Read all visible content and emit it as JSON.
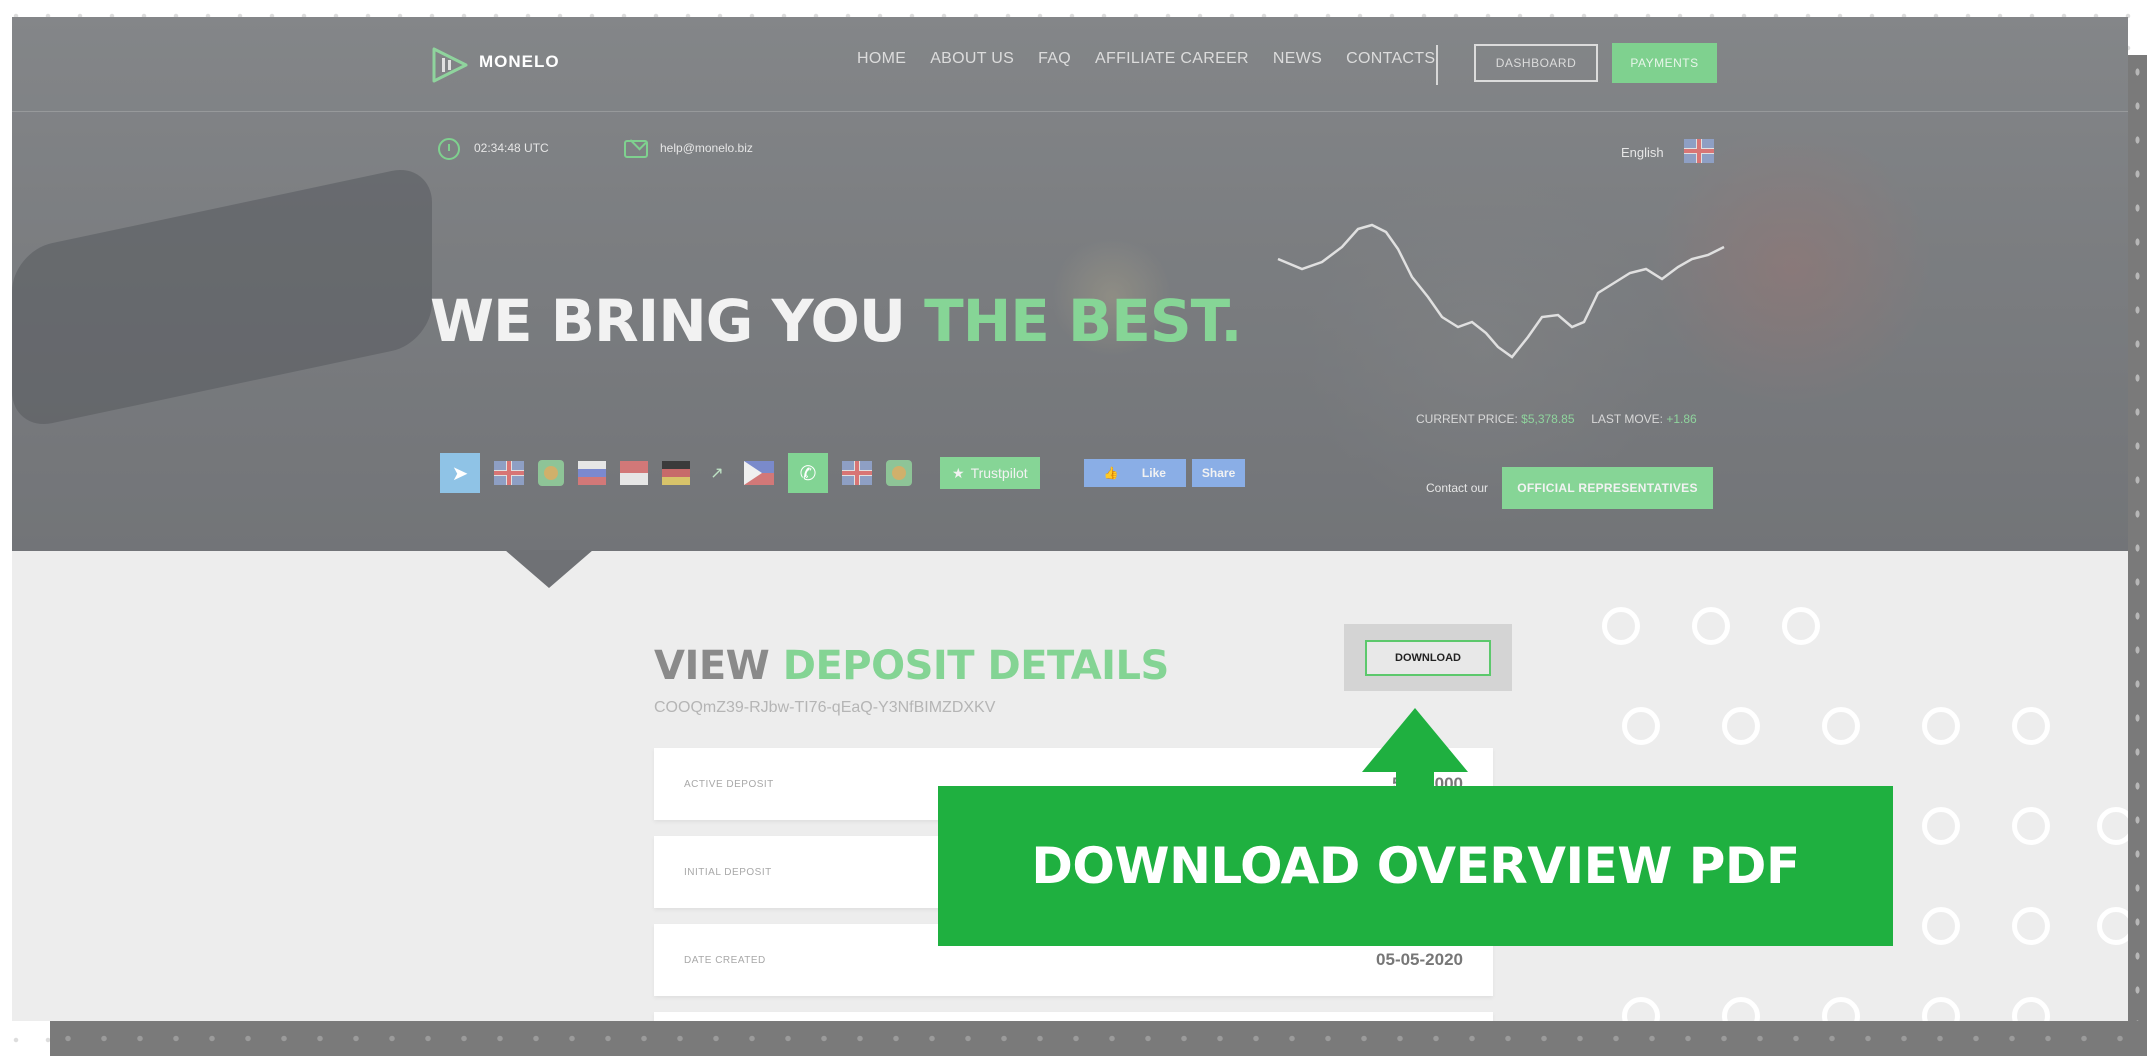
{
  "brand": {
    "name": "MONELO"
  },
  "nav": {
    "items": [
      "HOME",
      "ABOUT US",
      "FAQ",
      "AFFILIATE CAREER",
      "NEWS",
      "CONTACTS"
    ],
    "dashboard_label": "DASHBOARD",
    "payments_label": "PAYMENTS"
  },
  "info": {
    "time": "02:34:48 UTC",
    "email": "help@monelo.biz",
    "language": "English"
  },
  "hero": {
    "headline_white": "WE BRING YOU",
    "headline_green": "THE BEST.",
    "current_price_label": "CURRENT PRICE:",
    "current_price_value": "$5,378.85",
    "last_move_label": "LAST MOVE:",
    "last_move_value": "+1.86",
    "contact_label": "Contact our",
    "representatives_label": "OFFICIAL REPRESENTATIVES"
  },
  "social": {
    "trustpilot": "Trustpilot",
    "like": "Like",
    "share": "Share"
  },
  "deposit": {
    "title_dark": "VIEW",
    "title_green": "DEPOSIT DETAILS",
    "id": "COOQmZ39-RJbw-TI76-qEaQ-Y3NfBIMZDXKV",
    "download_label": "DOWNLOAD",
    "rows": [
      {
        "label": "ACTIVE DEPOSIT",
        "value": "5.000000"
      },
      {
        "label": "INITIAL DEPOSIT",
        "value": ""
      },
      {
        "label": "DATE CREATED",
        "value": "05-05-2020"
      }
    ]
  },
  "overlay": {
    "banner_text": "DOWNLOAD OVERVIEW PDF"
  },
  "colors": {
    "accent_green": "#86d596",
    "banner_green": "#1fb040"
  }
}
